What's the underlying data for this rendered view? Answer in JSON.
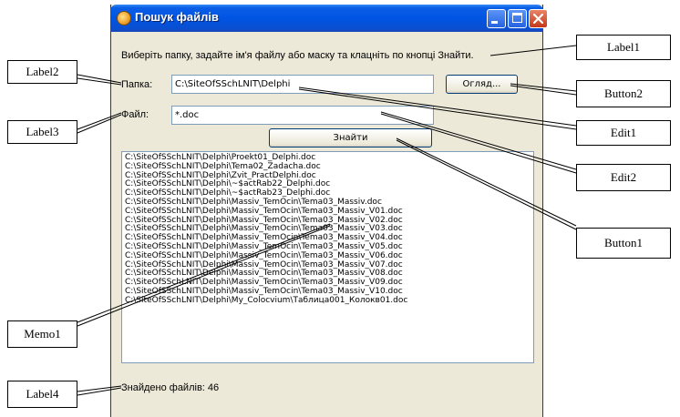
{
  "window": {
    "title": "Пошук файлів",
    "instruction": "Виберіть папку, задайте ім'я файлу або маску та клацніть по кнопці Знайти.",
    "folder_label": "Папка:",
    "folder_value": "C:\\SiteOfSSchLNIT\\Delphi",
    "browse_button": "Огляд...",
    "file_label": "Файл:",
    "file_value": "*.doc",
    "find_button": "Знайти",
    "memo_lines": [
      "C:\\SiteOfSSchLNIT\\Delphi\\Proekt01_Delphi.doc",
      "C:\\SiteOfSSchLNIT\\Delphi\\Tema02_Zadacha.doc",
      "C:\\SiteOfSSchLNIT\\Delphi\\Zvit_PractDelphi.doc",
      "C:\\SiteOfSSchLNIT\\Delphi\\~$actRab22_Delphi.doc",
      "C:\\SiteOfSSchLNIT\\Delphi\\~$actRab23_Delphi.doc",
      "C:\\SiteOfSSchLNIT\\Delphi\\Massiv_TemOcin\\Tema03_Massiv.doc",
      "C:\\SiteOfSSchLNIT\\Delphi\\Massiv_TemOcin\\Tema03_Massiv_V01.doc",
      "C:\\SiteOfSSchLNIT\\Delphi\\Massiv_TemOcin\\Tema03_Massiv_V02.doc",
      "C:\\SiteOfSSchLNIT\\Delphi\\Massiv_TemOcin\\Tema03_Massiv_V03.doc",
      "C:\\SiteOfSSchLNIT\\Delphi\\Massiv_TemOcin\\Tema03_Massiv_V04.doc",
      "C:\\SiteOfSSchLNIT\\Delphi\\Massiv_TemOcin\\Tema03_Massiv_V05.doc",
      "C:\\SiteOfSSchLNIT\\Delphi\\Massiv_TemOcin\\Tema03_Massiv_V06.doc",
      "C:\\SiteOfSSchLNIT\\Delphi\\Massiv_TemOcin\\Tema03_Massiv_V07.doc",
      "C:\\SiteOfSSchLNIT\\Delphi\\Massiv_TemOcin\\Tema03_Massiv_V08.doc",
      "C:\\SiteOfSSchLNIT\\Delphi\\Massiv_TemOcin\\Tema03_Massiv_V09.doc",
      "C:\\SiteOfSSchLNIT\\Delphi\\Massiv_TemOcin\\Tema03_Massiv_V10.doc",
      "C:\\SiteOfSSchLNIT\\Delphi\\My_Colocvium\\Таблица001_Колокв01.doc"
    ],
    "found_text": "Знайдено файлів: 46"
  },
  "callouts": {
    "label1": "Label1",
    "label2": "Label2",
    "label3": "Label3",
    "label4": "Label4",
    "button1": "Button1",
    "button2": "Button2",
    "edit1": "Edit1",
    "edit2": "Edit2",
    "memo1": "Memo1"
  },
  "icons": [
    "app-icon",
    "minimize-icon",
    "maximize-icon",
    "close-icon"
  ]
}
